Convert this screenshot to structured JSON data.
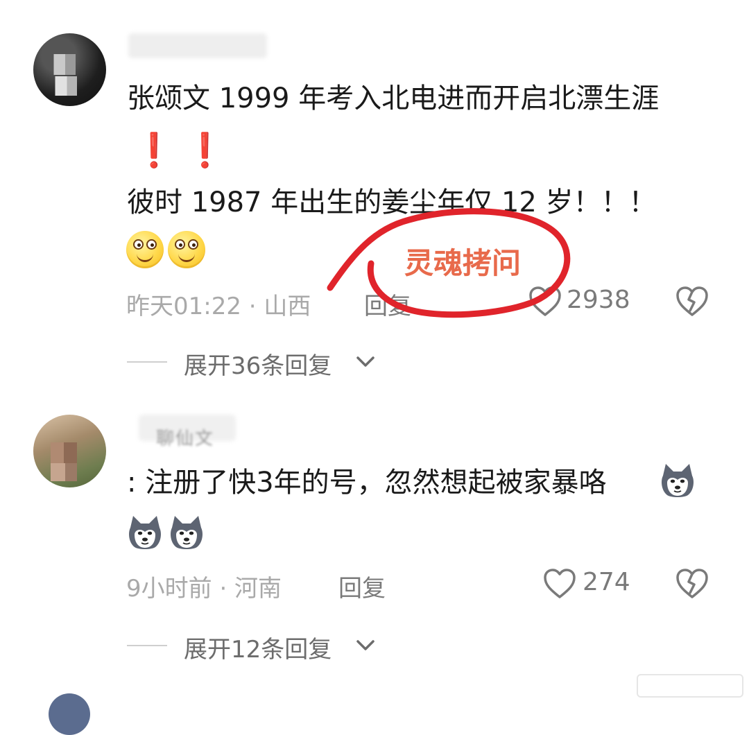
{
  "comments": [
    {
      "text_line1": "张颂文 1999 年考入北电进而开启北漂生涯",
      "exclaim": "❗❗",
      "text_line2": "彼时 1987 年出生的姜尘年仅 12 岁！！！",
      "emoji": "smiley",
      "meta": "昨天01:22 · 山西",
      "reply_label": "回复",
      "likes": "2938",
      "expand_label": "展开36条回复"
    },
    {
      "username": "聊仙文",
      "text_line1": ": 注册了快3年的号，忽然想起被家暴咯",
      "emoji": "husky",
      "meta": "9小时前 · 河南",
      "reply_label": "回复",
      "likes": "274",
      "expand_label": "展开12条回复"
    }
  ],
  "annotation": {
    "text": "灵魂拷问",
    "color": "#e0242b",
    "text_color": "#e86a4b"
  },
  "icons": {
    "like": "heart-outline-icon",
    "dislike": "broken-heart-icon",
    "expand": "chevron-down-icon"
  }
}
